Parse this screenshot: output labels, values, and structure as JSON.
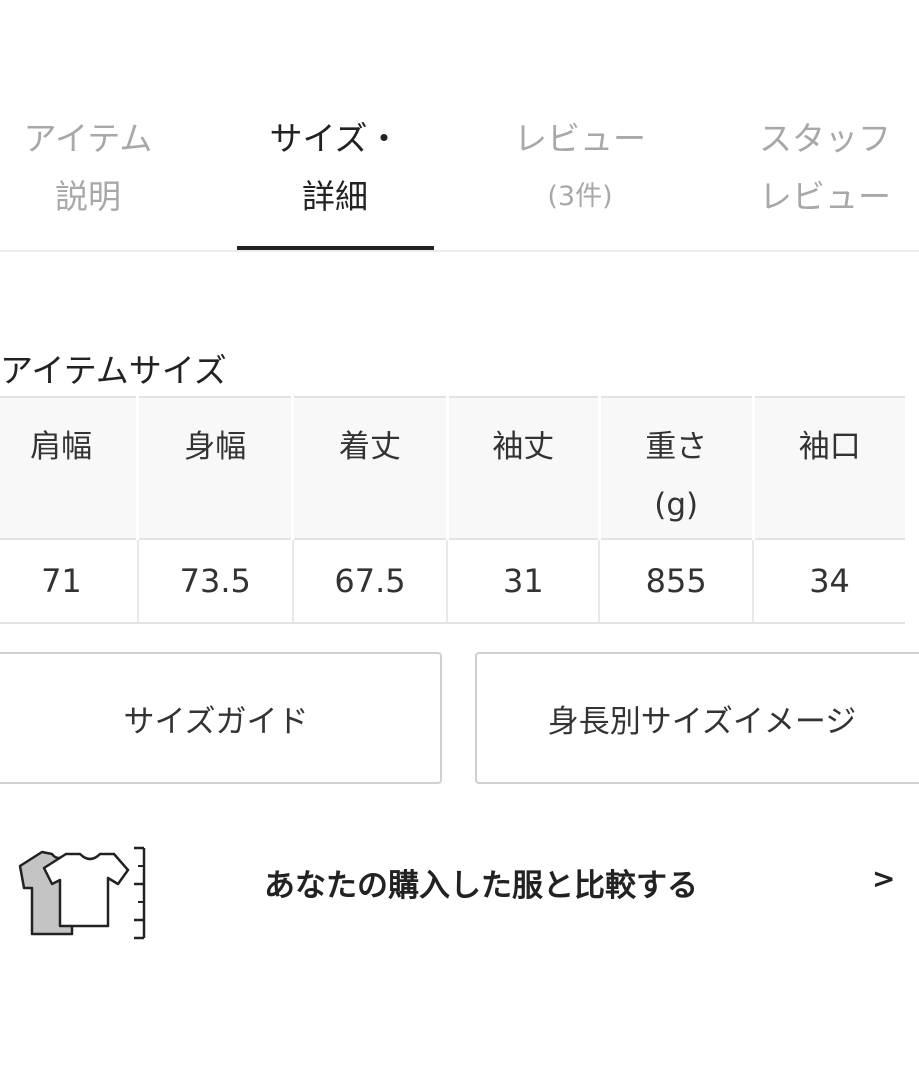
{
  "tabs": [
    {
      "line1": "アイテム",
      "line2": "説明",
      "active": false
    },
    {
      "line1": "サイズ・",
      "line2": "詳細",
      "active": true
    },
    {
      "line1": "レビュー",
      "line2": "(3件)",
      "active": false
    },
    {
      "line1": "スタッフ",
      "line2": "レビュー",
      "active": false
    }
  ],
  "item_size": {
    "title": "アイテムサイズ",
    "headers": [
      "肩幅",
      "身幅",
      "着丈",
      "袖丈",
      "重さ",
      "袖口"
    ],
    "weight_unit": "(g)",
    "values": [
      "71",
      "73.5",
      "67.5",
      "31",
      "855",
      "34"
    ]
  },
  "buttons": {
    "size_guide": "サイズガイド",
    "height_image": "身長別サイズイメージ"
  },
  "compare": {
    "label": "あなたの購入した服と比較する",
    "arrow": ">",
    "icon": "t-shirt-compare-icon"
  },
  "colors": {
    "text": "#222222",
    "inactive_tab": "#a8a8a8",
    "border": "#e3e3e3",
    "header_bg": "#f8f8f8"
  }
}
